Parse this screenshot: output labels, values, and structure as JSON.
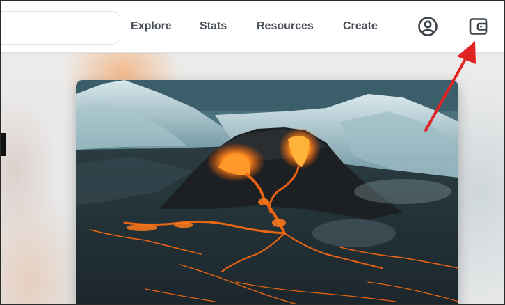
{
  "header": {
    "search": {
      "value": "",
      "placeholder": ""
    },
    "nav": [
      {
        "label": "Explore"
      },
      {
        "label": "Stats"
      },
      {
        "label": "Resources"
      },
      {
        "label": "Create"
      }
    ],
    "icons": {
      "profile": "profile-icon",
      "wallet": "wallet-icon"
    }
  },
  "colors": {
    "nav_text": "#4a5058",
    "icon_stroke": "#3d434a",
    "annotation_arrow": "#e02424",
    "lava": "#ff7a1a"
  },
  "main": {
    "hero_image": "volcano-eruption-image"
  }
}
